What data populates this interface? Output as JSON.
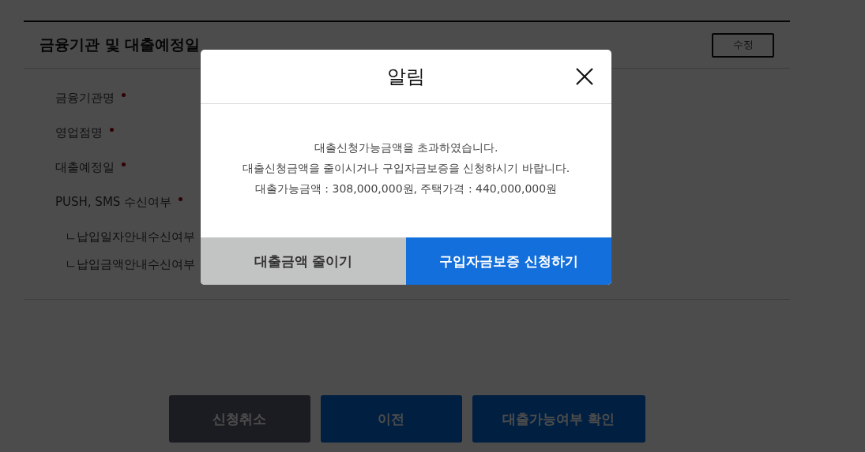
{
  "section": {
    "title": "금융기관 및 대출예정일",
    "edit_button": "수정",
    "fields": [
      {
        "label": "금융기관명",
        "required": true
      },
      {
        "label": "영업점명",
        "required": true
      },
      {
        "label": "대출예정일",
        "required": true
      },
      {
        "label": "PUSH, SMS 수신여부",
        "required": true,
        "children": [
          {
            "label": "ㄴ납입일자안내수신여부"
          },
          {
            "label": "ㄴ납입금액안내수신여부"
          }
        ]
      }
    ]
  },
  "page_buttons": [
    {
      "label": "신청취소",
      "kind": "cancel"
    },
    {
      "label": "이전",
      "kind": "primary"
    },
    {
      "label": "대출가능여부 확인",
      "kind": "primary"
    }
  ],
  "dialog": {
    "title": "알림",
    "message": [
      "대출신청가능금액을 초과하였습니다.",
      "대출신청금액을 줄이시거나 구입자금보증을 신청하시기 바랍니다.",
      "대출가능금액 : 308,000,000원, 주택가격 : 440,000,000원"
    ],
    "buttons": [
      {
        "label": "대출금액 줄이기",
        "kind": "secondary"
      },
      {
        "label": "구입자금보증 신청하기",
        "kind": "primary"
      }
    ]
  }
}
